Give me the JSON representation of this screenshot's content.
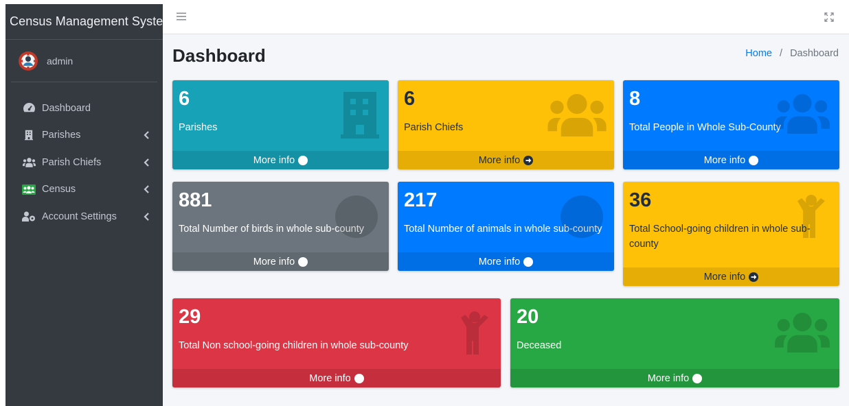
{
  "app": {
    "brand": "Census Management System",
    "user": "admin"
  },
  "sidebar": {
    "items": [
      {
        "label": "Dashboard",
        "icon": "tachometer-icon"
      },
      {
        "label": "Parishes",
        "icon": "building-icon"
      },
      {
        "label": "Parish Chiefs",
        "icon": "users-icon"
      },
      {
        "label": "Census",
        "icon": "users-group-icon"
      },
      {
        "label": "Account Settings",
        "icon": "user-cog-icon"
      }
    ]
  },
  "header": {
    "title": "Dashboard",
    "breadcrumb": {
      "home": "Home",
      "current": "Dashboard",
      "separator": "/"
    }
  },
  "boxes": [
    {
      "value": "6",
      "label": "Parishes",
      "link": "More info",
      "color": "#17a2b8",
      "icon": "building-icon"
    },
    {
      "value": "6",
      "label": "Parish Chiefs",
      "link": "More info",
      "color": "#ffc107",
      "icon": "users-icon"
    },
    {
      "value": "8",
      "label": "Total People in Whole Sub-County",
      "link": "More info",
      "color": "#007bff",
      "icon": "users-icon"
    },
    {
      "value": "881",
      "label": "Total Number of birds in whole sub-county",
      "link": "More info",
      "color": "#6c757d",
      "icon": "circle-icon"
    },
    {
      "value": "217",
      "label": "Total Number of animals in whole sub-county",
      "link": "More info",
      "color": "#007bff",
      "icon": "circle-icon"
    },
    {
      "value": "36",
      "label": "Total School-going children in whole sub-county",
      "link": "More info",
      "color": "#ffc107",
      "icon": "child-icon"
    },
    {
      "value": "29",
      "label": "Total Non school-going children in whole sub-county",
      "link": "More info",
      "color": "#dc3545",
      "icon": "child-icon"
    },
    {
      "value": "20",
      "label": "Deceased",
      "link": "More info",
      "color": "#28a745",
      "icon": "users-icon"
    }
  ]
}
